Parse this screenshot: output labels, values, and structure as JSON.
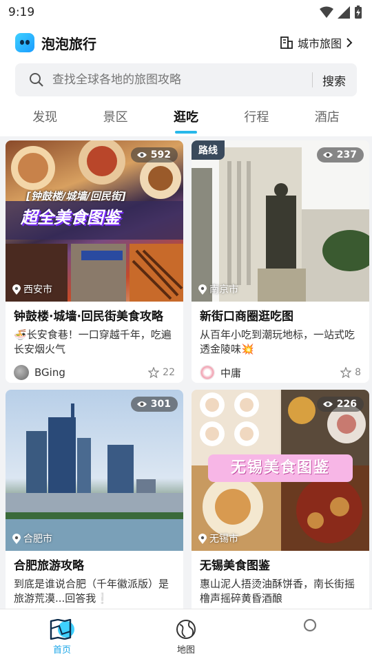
{
  "status": {
    "time": "9:19"
  },
  "app": {
    "name": "泡泡旅行",
    "city_map_label": "城市旅图"
  },
  "search": {
    "placeholder": "查找全球各地的旅图攻略",
    "button": "搜索"
  },
  "tabs": [
    {
      "label": "发现"
    },
    {
      "label": "景区"
    },
    {
      "label": "逛吃",
      "active": true
    },
    {
      "label": "行程"
    },
    {
      "label": "酒店"
    }
  ],
  "cards": [
    {
      "views": "592",
      "city": "西安市",
      "overlay_text": [
        "[钟鼓楼/城墙/回民街]",
        "超全美食图鉴"
      ],
      "title": "钟鼓楼·城墙·回民街美食攻略",
      "desc_emoji": "🍜",
      "desc": "长安食巷！一口穿越千年，吃遍长安烟火气",
      "author": "BGing",
      "likes": "22"
    },
    {
      "views": "237",
      "tag": "路线",
      "city": "南京市",
      "title": "新街口商圈逛吃图",
      "desc": "从百年小吃到潮玩地标，一站式吃透金陵味",
      "desc_emoji_after": "💥",
      "author": "中庸",
      "likes": "8"
    },
    {
      "views": "301",
      "city": "合肥市",
      "title": "合肥旅游攻略",
      "desc": "到底是谁说合肥（千年徽派版）是旅游荒漠...回答我",
      "desc_emoji_after": "❕"
    },
    {
      "views": "226",
      "city": "无锡市",
      "overlay_text": [
        "无锡美食图鉴"
      ],
      "title": "无锡美食图鉴",
      "desc": "惠山泥人捂烫油酥饼香，南长街摇橹声摇碎黄昏酒酿"
    }
  ],
  "nav": [
    {
      "label": "首页",
      "active": true
    },
    {
      "label": "地图"
    },
    {
      "label": ""
    }
  ],
  "colors": {
    "accent": "#1ba6e8",
    "tab_underline": "#27b8ea"
  }
}
